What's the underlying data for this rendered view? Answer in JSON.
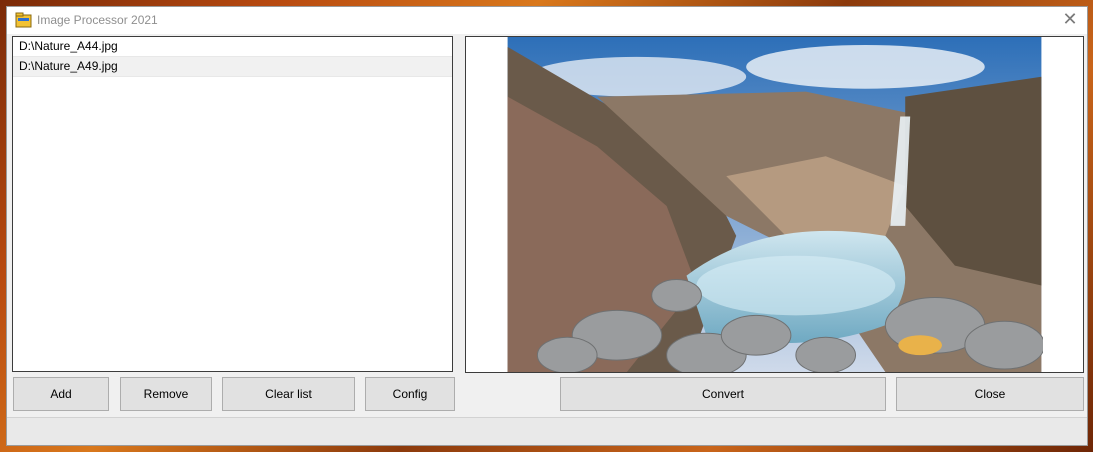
{
  "window": {
    "title": "Image Processor 2021",
    "close_glyph": "✕"
  },
  "files": [
    "D:\\Nature_A44.jpg",
    "D:\\Nature_A49.jpg"
  ],
  "selected_index": 1,
  "preview": {
    "description_icon": "landscape-photo"
  },
  "buttons": {
    "add": "Add",
    "remove": "Remove",
    "clear_list": "Clear list",
    "config": "Config",
    "convert": "Convert",
    "close": "Close"
  },
  "status": {
    "text": ""
  }
}
